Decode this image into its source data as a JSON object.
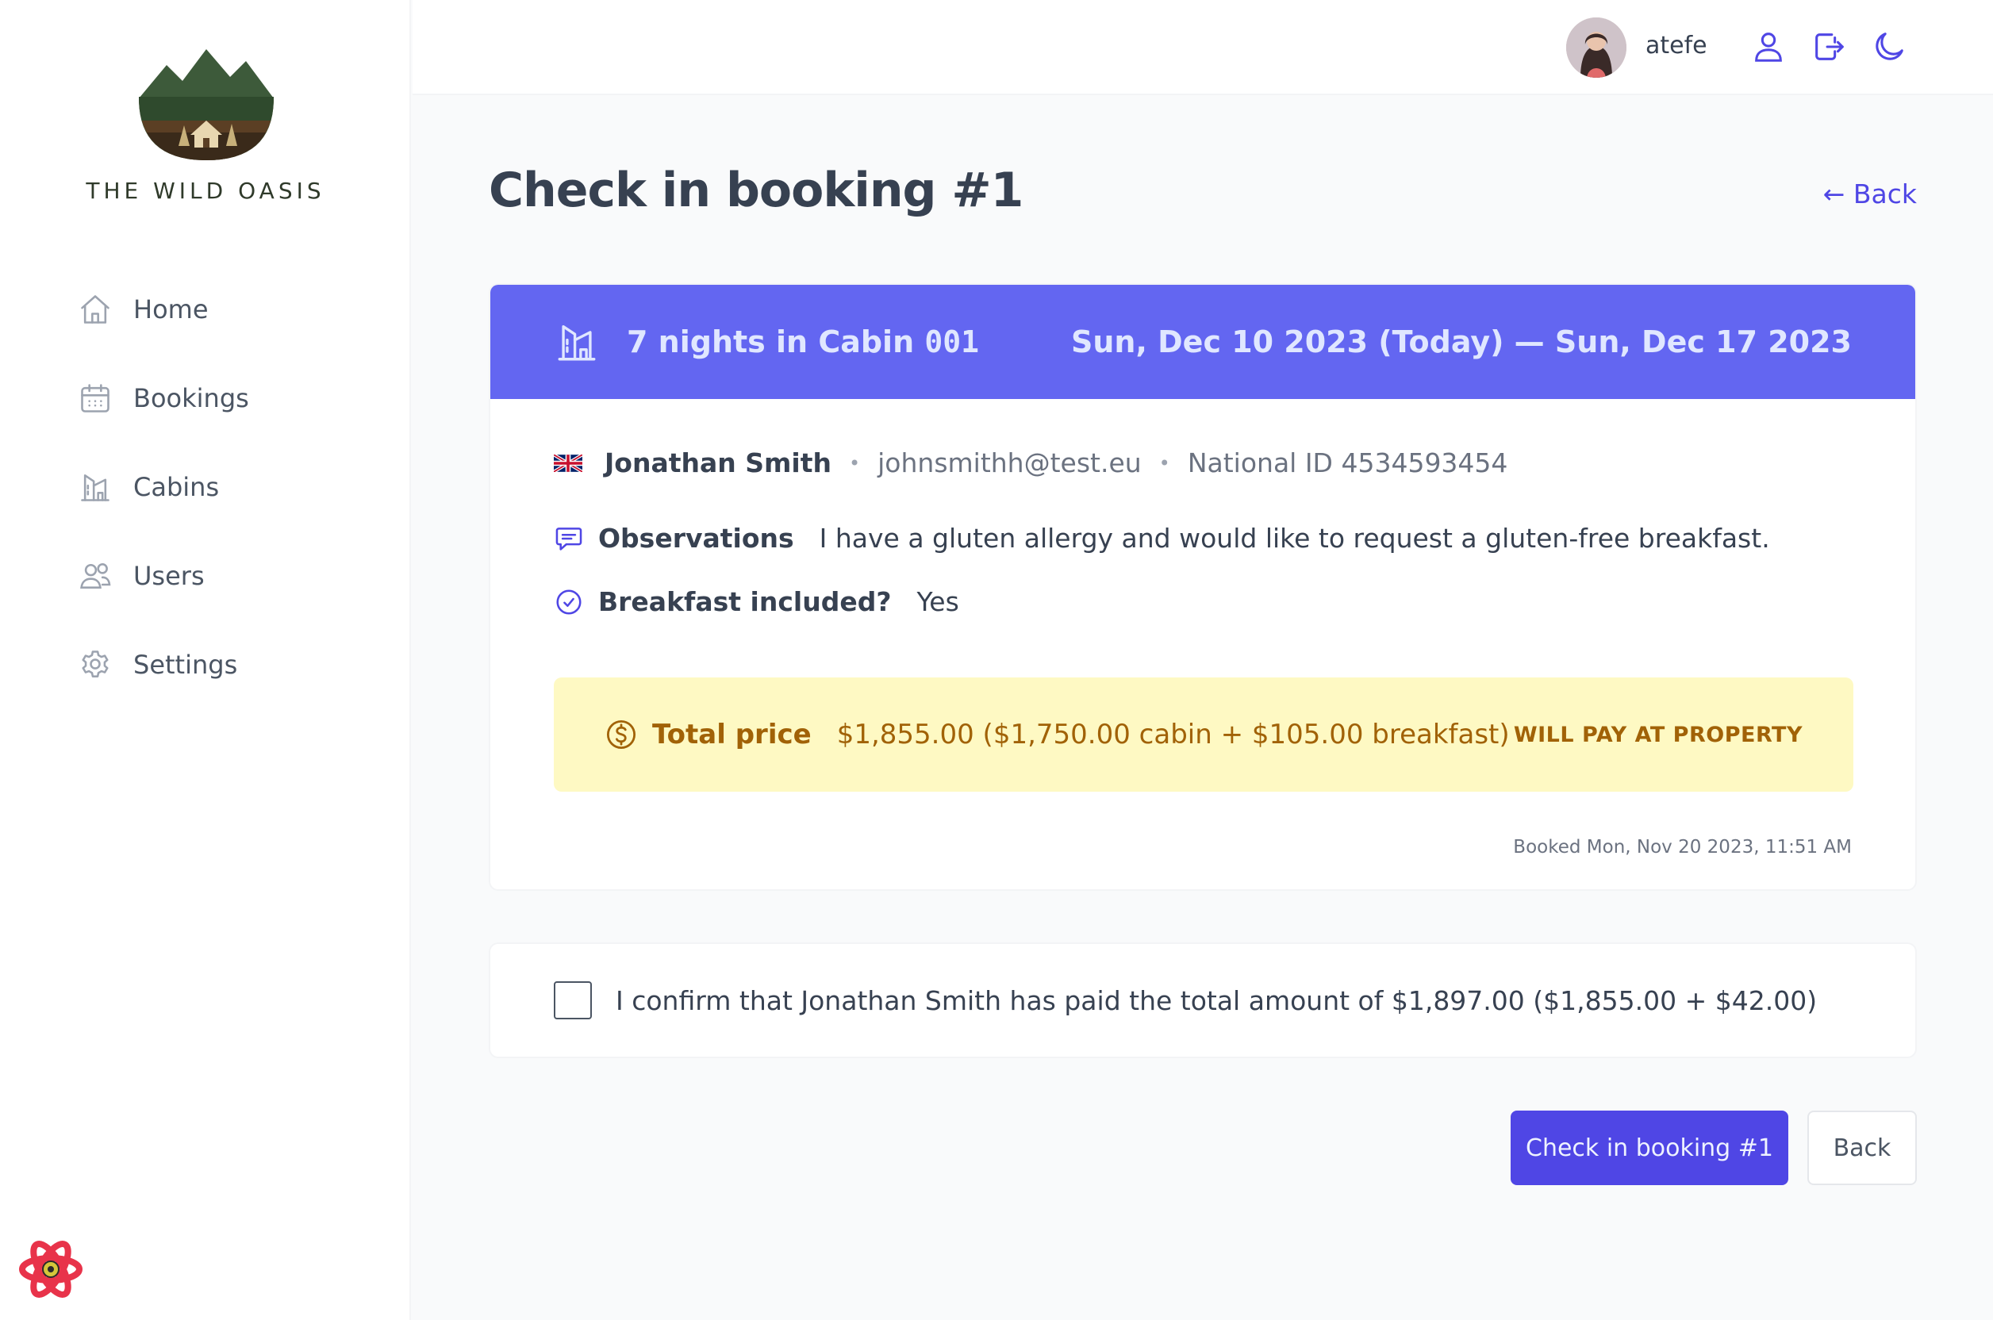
{
  "brand": {
    "name": "THE WILD OASIS"
  },
  "nav": {
    "items": [
      {
        "label": "Home",
        "icon": "home-icon"
      },
      {
        "label": "Bookings",
        "icon": "calendar-icon"
      },
      {
        "label": "Cabins",
        "icon": "cabin-icon"
      },
      {
        "label": "Users",
        "icon": "users-icon"
      },
      {
        "label": "Settings",
        "icon": "gear-icon"
      }
    ]
  },
  "header": {
    "username": "atefe",
    "icons": [
      "user-icon",
      "logout-icon",
      "moon-icon"
    ]
  },
  "page": {
    "title": "Check in booking #1",
    "back_link": "← Back"
  },
  "booking": {
    "nights_text": "7 nights in Cabin",
    "cabin_number": "001",
    "dates": "Sun, Dec 10 2023 (Today) — Sun, Dec 17 2023",
    "guest": {
      "name": "Jonathan Smith",
      "email": "johnsmithh@test.eu",
      "national_id": "National ID 4534593454",
      "separator": "•"
    },
    "observations": {
      "label": "Observations",
      "value": "I have a gluten allergy and would like to request a gluten-free breakfast."
    },
    "breakfast": {
      "label": "Breakfast included?",
      "value": "Yes"
    },
    "price": {
      "label": "Total price",
      "value": "$1,855.00 ($1,750.00 cabin + $105.00 breakfast)",
      "status": "WILL PAY AT PROPERTY"
    },
    "booked_at": "Booked Mon, Nov 20 2023, 11:51 AM"
  },
  "confirm": {
    "text": "I confirm that Jonathan Smith has paid the total amount of $1,897.00 ($1,855.00 + $42.00)",
    "checked": false
  },
  "actions": {
    "checkin_label": "Check in booking #1",
    "back_label": "Back"
  },
  "colors": {
    "accent": "#4f46e5",
    "header_band": "#6366f1",
    "price_bg": "#fef9c3",
    "price_text": "#a16207"
  }
}
